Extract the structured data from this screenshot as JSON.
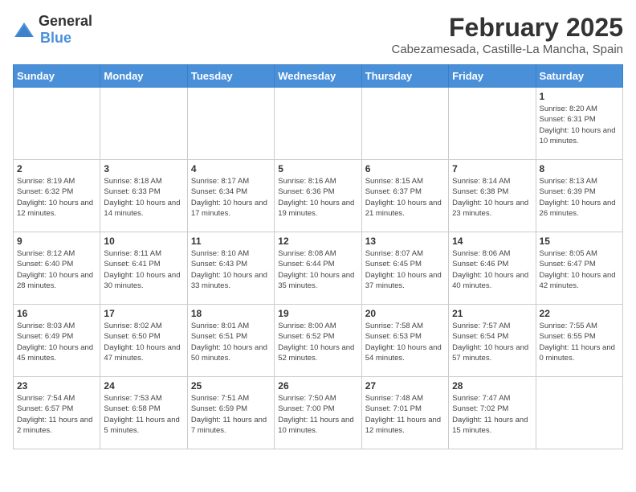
{
  "logo": {
    "general": "General",
    "blue": "Blue"
  },
  "title": "February 2025",
  "subtitle": "Cabezamesada, Castille-La Mancha, Spain",
  "days_of_week": [
    "Sunday",
    "Monday",
    "Tuesday",
    "Wednesday",
    "Thursday",
    "Friday",
    "Saturday"
  ],
  "weeks": [
    [
      {
        "day": "",
        "info": ""
      },
      {
        "day": "",
        "info": ""
      },
      {
        "day": "",
        "info": ""
      },
      {
        "day": "",
        "info": ""
      },
      {
        "day": "",
        "info": ""
      },
      {
        "day": "",
        "info": ""
      },
      {
        "day": "1",
        "info": "Sunrise: 8:20 AM\nSunset: 6:31 PM\nDaylight: 10 hours and 10 minutes."
      }
    ],
    [
      {
        "day": "2",
        "info": "Sunrise: 8:19 AM\nSunset: 6:32 PM\nDaylight: 10 hours and 12 minutes."
      },
      {
        "day": "3",
        "info": "Sunrise: 8:18 AM\nSunset: 6:33 PM\nDaylight: 10 hours and 14 minutes."
      },
      {
        "day": "4",
        "info": "Sunrise: 8:17 AM\nSunset: 6:34 PM\nDaylight: 10 hours and 17 minutes."
      },
      {
        "day": "5",
        "info": "Sunrise: 8:16 AM\nSunset: 6:36 PM\nDaylight: 10 hours and 19 minutes."
      },
      {
        "day": "6",
        "info": "Sunrise: 8:15 AM\nSunset: 6:37 PM\nDaylight: 10 hours and 21 minutes."
      },
      {
        "day": "7",
        "info": "Sunrise: 8:14 AM\nSunset: 6:38 PM\nDaylight: 10 hours and 23 minutes."
      },
      {
        "day": "8",
        "info": "Sunrise: 8:13 AM\nSunset: 6:39 PM\nDaylight: 10 hours and 26 minutes."
      }
    ],
    [
      {
        "day": "9",
        "info": "Sunrise: 8:12 AM\nSunset: 6:40 PM\nDaylight: 10 hours and 28 minutes."
      },
      {
        "day": "10",
        "info": "Sunrise: 8:11 AM\nSunset: 6:41 PM\nDaylight: 10 hours and 30 minutes."
      },
      {
        "day": "11",
        "info": "Sunrise: 8:10 AM\nSunset: 6:43 PM\nDaylight: 10 hours and 33 minutes."
      },
      {
        "day": "12",
        "info": "Sunrise: 8:08 AM\nSunset: 6:44 PM\nDaylight: 10 hours and 35 minutes."
      },
      {
        "day": "13",
        "info": "Sunrise: 8:07 AM\nSunset: 6:45 PM\nDaylight: 10 hours and 37 minutes."
      },
      {
        "day": "14",
        "info": "Sunrise: 8:06 AM\nSunset: 6:46 PM\nDaylight: 10 hours and 40 minutes."
      },
      {
        "day": "15",
        "info": "Sunrise: 8:05 AM\nSunset: 6:47 PM\nDaylight: 10 hours and 42 minutes."
      }
    ],
    [
      {
        "day": "16",
        "info": "Sunrise: 8:03 AM\nSunset: 6:49 PM\nDaylight: 10 hours and 45 minutes."
      },
      {
        "day": "17",
        "info": "Sunrise: 8:02 AM\nSunset: 6:50 PM\nDaylight: 10 hours and 47 minutes."
      },
      {
        "day": "18",
        "info": "Sunrise: 8:01 AM\nSunset: 6:51 PM\nDaylight: 10 hours and 50 minutes."
      },
      {
        "day": "19",
        "info": "Sunrise: 8:00 AM\nSunset: 6:52 PM\nDaylight: 10 hours and 52 minutes."
      },
      {
        "day": "20",
        "info": "Sunrise: 7:58 AM\nSunset: 6:53 PM\nDaylight: 10 hours and 54 minutes."
      },
      {
        "day": "21",
        "info": "Sunrise: 7:57 AM\nSunset: 6:54 PM\nDaylight: 10 hours and 57 minutes."
      },
      {
        "day": "22",
        "info": "Sunrise: 7:55 AM\nSunset: 6:55 PM\nDaylight: 11 hours and 0 minutes."
      }
    ],
    [
      {
        "day": "23",
        "info": "Sunrise: 7:54 AM\nSunset: 6:57 PM\nDaylight: 11 hours and 2 minutes."
      },
      {
        "day": "24",
        "info": "Sunrise: 7:53 AM\nSunset: 6:58 PM\nDaylight: 11 hours and 5 minutes."
      },
      {
        "day": "25",
        "info": "Sunrise: 7:51 AM\nSunset: 6:59 PM\nDaylight: 11 hours and 7 minutes."
      },
      {
        "day": "26",
        "info": "Sunrise: 7:50 AM\nSunset: 7:00 PM\nDaylight: 11 hours and 10 minutes."
      },
      {
        "day": "27",
        "info": "Sunrise: 7:48 AM\nSunset: 7:01 PM\nDaylight: 11 hours and 12 minutes."
      },
      {
        "day": "28",
        "info": "Sunrise: 7:47 AM\nSunset: 7:02 PM\nDaylight: 11 hours and 15 minutes."
      },
      {
        "day": "",
        "info": ""
      }
    ]
  ]
}
